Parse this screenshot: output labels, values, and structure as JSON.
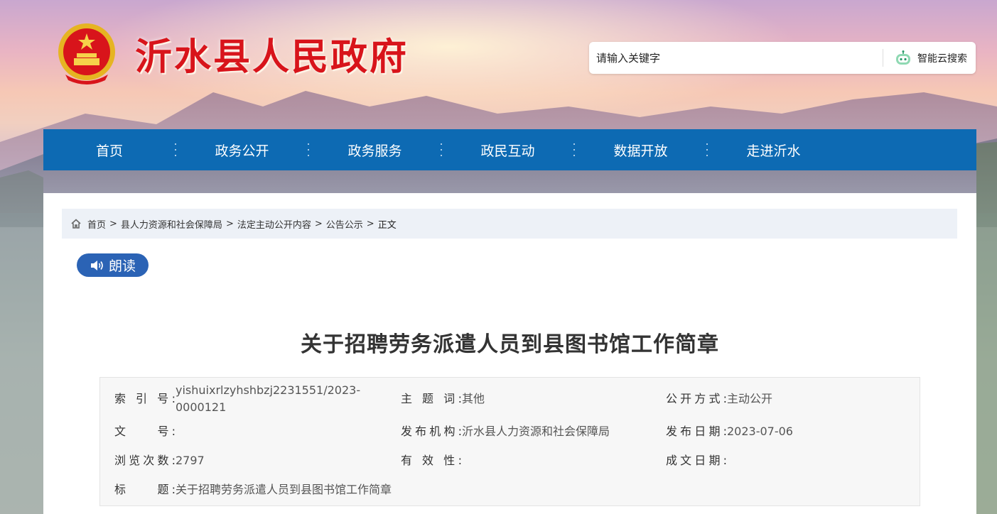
{
  "header": {
    "site_title": "沂水县人民政府",
    "search": {
      "placeholder": "请输入关键字",
      "button_label": "智能云搜索"
    }
  },
  "nav": {
    "items": [
      {
        "label": "首页"
      },
      {
        "label": "政务公开"
      },
      {
        "label": "政务服务"
      },
      {
        "label": "政民互动"
      },
      {
        "label": "数据开放"
      },
      {
        "label": "走进沂水"
      }
    ]
  },
  "breadcrumb": {
    "items": [
      "首页",
      "县人力资源和社会保障局",
      "法定主动公开内容",
      "公告公示"
    ],
    "separator": ">",
    "current": "正文"
  },
  "read_button": {
    "label": "朗读"
  },
  "article": {
    "title": "关于招聘劳务派遣人员到县图书馆工作简章"
  },
  "meta": {
    "index_no": {
      "label": "索 引 号:",
      "value_line1": "yishuixrlzyhshbzj2231551/2023-",
      "value_line2": "0000121"
    },
    "subject": {
      "label": "主 题 词:",
      "value": "其他"
    },
    "open_mode": {
      "label": "公开方式:",
      "value": "主动公开"
    },
    "doc_no": {
      "label": "文　　号:",
      "value": ""
    },
    "publisher": {
      "label": "发布机构:",
      "value": "沂水县人力资源和社会保障局"
    },
    "publish_date": {
      "label": "发布日期:",
      "value": "2023-07-06"
    },
    "views": {
      "label": "浏览次数:",
      "value": "2797"
    },
    "validity": {
      "label": "有 效 性:",
      "value": ""
    },
    "created_date": {
      "label": "成文日期:",
      "value": ""
    },
    "title": {
      "label": "标　　题:",
      "value": "关于招聘劳务派遣人员到县图书馆工作简章"
    }
  },
  "colors": {
    "nav_bg": "#0d6ab3",
    "title_red": "#d8141b",
    "read_button_bg": "#2b63b5",
    "breadcrumb_bg": "#edf1f7"
  },
  "icons": {
    "emblem": "national-emblem",
    "search_bot": "robot-icon",
    "home": "home-icon",
    "speaker": "speaker-icon"
  }
}
